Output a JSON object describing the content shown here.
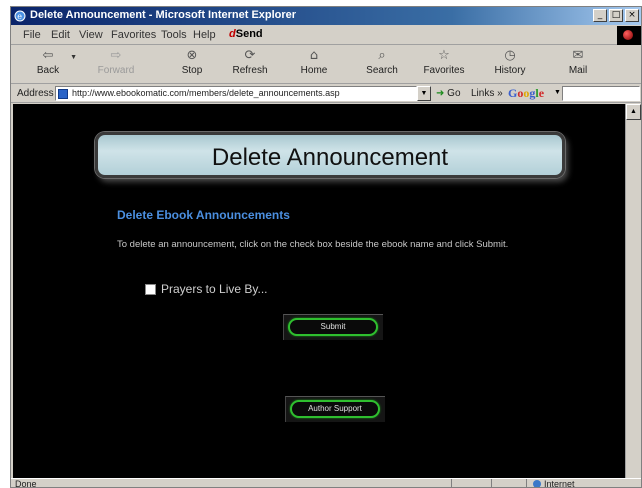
{
  "window": {
    "title": "Delete Announcement - Microsoft Internet Explorer",
    "controls": [
      "_",
      "□",
      "×"
    ]
  },
  "menubar": {
    "items": [
      "File",
      "Edit",
      "View",
      "Favorites",
      "Tools",
      "Help"
    ],
    "send_label": "Send",
    "send_prefix": "d"
  },
  "toolbar": {
    "back": "Back",
    "forward": "Forward",
    "stop": "Stop",
    "refresh": "Refresh",
    "home": "Home",
    "search": "Search",
    "favorites": "Favorites",
    "history": "History",
    "mail": "Mail"
  },
  "addressbar": {
    "label": "Address",
    "url": "http://www.ebookomatic.com/members/delete_announcements.asp",
    "go": "Go",
    "links": "Links »",
    "google": "Google"
  },
  "page": {
    "banner_title": "Delete Announcement",
    "section_heading": "Delete Ebook Announcements",
    "instructions": "To delete an announcement, click on the check box beside the ebook name and click Submit.",
    "ebooks": [
      {
        "name": "Prayers to Live By...",
        "checked": false
      }
    ],
    "submit_label": "Submit",
    "support_label": "Author Support"
  },
  "statusbar": {
    "status": "Done",
    "zone": "Internet"
  },
  "colors": {
    "page_bg": "#000000",
    "heading_blue": "#4b8fe0",
    "button_green": "#2fbf2f",
    "banner_bg": "#cfe3e8",
    "titlebar_blue": "#0a246a"
  }
}
